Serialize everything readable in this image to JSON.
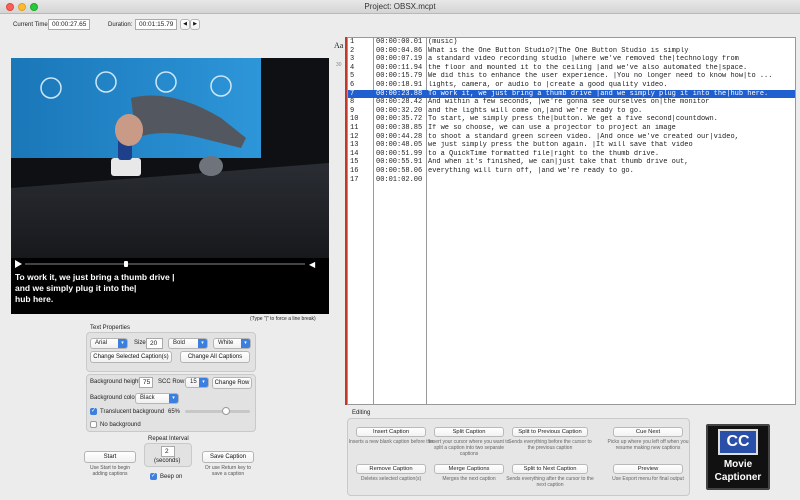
{
  "window": {
    "title": "Project: OBSX.mcpt"
  },
  "header": {
    "current_time_label": "Current Time:",
    "current_time": "00:00:27.65",
    "duration_label": "Duration:",
    "duration": "00:01:15.79"
  },
  "video": {
    "caption": "To work it, we just bring a thumb drive |\nand we simply plug it into the|\nhub here.",
    "hint": "(Type \"|\" to force a line break)",
    "progress": 0.36
  },
  "text_properties": {
    "title": "Text Properties",
    "font": "Arial",
    "size_label": "Size",
    "size": "20",
    "weight": "Bold",
    "color": "White",
    "change_selected": "Change Selected Caption(s)",
    "change_all": "Change All Captions"
  },
  "background": {
    "height_label": "Background height",
    "height": "75",
    "scc_label": "SCC Row:",
    "scc_row": "15",
    "change_row": "Change Row",
    "color_label": "Background color",
    "color": "Black",
    "translucent_label": "Translucent background",
    "translucent_value": "65%",
    "translucent_fraction": 0.65,
    "no_bg_label": "No background"
  },
  "controls": {
    "start": "Start",
    "start_desc": "Use Start to begin adding captions",
    "repeat_label": "Repeat Interval",
    "repeat_value": "2",
    "repeat_unit": "(seconds)",
    "beep_label": "Beep on",
    "save": "Save Caption",
    "save_desc": "Or use Return key to save a caption"
  },
  "aa_label": "Aa",
  "font_size_value": "30",
  "captions": [
    {
      "n": "1",
      "t": "00:00:00.01",
      "text": "(music)"
    },
    {
      "n": "2",
      "t": "00:00:04.86",
      "text": "What is the One Button Studio?|The One Button Studio is simply"
    },
    {
      "n": "3",
      "t": "00:00:07.19",
      "text": "a standard video recording studio |where we've removed the|technology from"
    },
    {
      "n": "4",
      "t": "00:00:11.94",
      "text": "the floor and mounted it to the ceiling |and we've also automated the|space."
    },
    {
      "n": "5",
      "t": "00:00:15.79",
      "text": "We did this to enhance the user experience. |You no longer need to know how|to ..."
    },
    {
      "n": "6",
      "t": "00:00:18.91",
      "text": "lights, camera, or audio to |create a good quality video."
    },
    {
      "n": "7",
      "t": "00:00:23.88",
      "text": "To work it, we just bring a thumb drive |and we simply plug it into the|hub here."
    },
    {
      "n": "8",
      "t": "00:00:28.42",
      "text": "And within a few seconds, |we're gonna see ourselves on|the monitor"
    },
    {
      "n": "9",
      "t": "00:00:32.20",
      "text": "and the lights will come on,|and we're ready to go."
    },
    {
      "n": "10",
      "t": "00:00:35.72",
      "text": "To start, we simply press the|button. We get a five second|countdown."
    },
    {
      "n": "11",
      "t": "00:00:38.85",
      "text": "If we so choose, we can use a projector to project an image"
    },
    {
      "n": "12",
      "t": "00:00:44.28",
      "text": "to shoot a standard green screen video. |And once we've created our|video,"
    },
    {
      "n": "13",
      "t": "00:00:48.05",
      "text": "we just simply press the button again. |It will save that video"
    },
    {
      "n": "14",
      "t": "00:00:51.99",
      "text": "to a QuickTime formatted file|right to the thumb drive."
    },
    {
      "n": "15",
      "t": "00:00:55.91",
      "text": "And when it's finished, we can|just take that thumb drive out,"
    },
    {
      "n": "16",
      "t": "00:00:58.06",
      "text": "everything will turn off, |and we're ready to go."
    },
    {
      "n": "17",
      "t": "00:01:02.00",
      "text": ""
    }
  ],
  "selected_row": 7,
  "editing": {
    "title": "Editing",
    "insert": "Insert Caption",
    "insert_desc": "Inserts a new blank caption before the",
    "split": "Split Caption",
    "split_desc": "Insert your cursor where you want to split a caption into two separate captions",
    "split_prev": "Split to Previous Caption",
    "split_prev_desc": "Sends everything before the cursor to the previous caption",
    "cue_next": "Cue Next",
    "cue_next_desc": "Picks up where you left off when you resume making new captions",
    "remove": "Remove Caption",
    "remove_desc": "Deletes selected caption(s)",
    "merge": "Merge Captions",
    "merge_desc": "Merges the next caption",
    "split_next": "Split to Next Caption",
    "split_next_desc": "Sends everything after the cursor to the next caption",
    "preview": "Preview",
    "preview_desc": "Use Export menu for final output"
  },
  "logo": {
    "top": "CC",
    "line1": "Movie",
    "line2": "Captioner"
  },
  "colors": {
    "selection": "#1f5fd0",
    "accent": "#3b7fe0",
    "marker": "#c0392b"
  }
}
